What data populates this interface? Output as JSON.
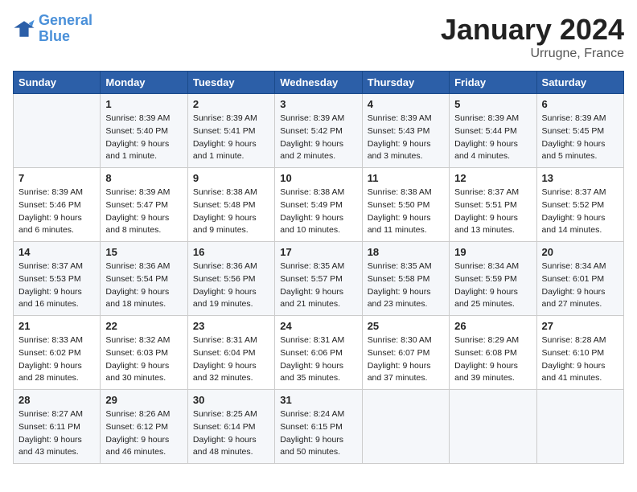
{
  "header": {
    "logo_line1": "General",
    "logo_line2": "Blue",
    "month": "January 2024",
    "location": "Urrugne, France"
  },
  "weekdays": [
    "Sunday",
    "Monday",
    "Tuesday",
    "Wednesday",
    "Thursday",
    "Friday",
    "Saturday"
  ],
  "weeks": [
    [
      {
        "day": "",
        "info": ""
      },
      {
        "day": "1",
        "info": "Sunrise: 8:39 AM\nSunset: 5:40 PM\nDaylight: 9 hours\nand 1 minute."
      },
      {
        "day": "2",
        "info": "Sunrise: 8:39 AM\nSunset: 5:41 PM\nDaylight: 9 hours\nand 1 minute."
      },
      {
        "day": "3",
        "info": "Sunrise: 8:39 AM\nSunset: 5:42 PM\nDaylight: 9 hours\nand 2 minutes."
      },
      {
        "day": "4",
        "info": "Sunrise: 8:39 AM\nSunset: 5:43 PM\nDaylight: 9 hours\nand 3 minutes."
      },
      {
        "day": "5",
        "info": "Sunrise: 8:39 AM\nSunset: 5:44 PM\nDaylight: 9 hours\nand 4 minutes."
      },
      {
        "day": "6",
        "info": "Sunrise: 8:39 AM\nSunset: 5:45 PM\nDaylight: 9 hours\nand 5 minutes."
      }
    ],
    [
      {
        "day": "7",
        "info": "Sunrise: 8:39 AM\nSunset: 5:46 PM\nDaylight: 9 hours\nand 6 minutes."
      },
      {
        "day": "8",
        "info": "Sunrise: 8:39 AM\nSunset: 5:47 PM\nDaylight: 9 hours\nand 8 minutes."
      },
      {
        "day": "9",
        "info": "Sunrise: 8:38 AM\nSunset: 5:48 PM\nDaylight: 9 hours\nand 9 minutes."
      },
      {
        "day": "10",
        "info": "Sunrise: 8:38 AM\nSunset: 5:49 PM\nDaylight: 9 hours\nand 10 minutes."
      },
      {
        "day": "11",
        "info": "Sunrise: 8:38 AM\nSunset: 5:50 PM\nDaylight: 9 hours\nand 11 minutes."
      },
      {
        "day": "12",
        "info": "Sunrise: 8:37 AM\nSunset: 5:51 PM\nDaylight: 9 hours\nand 13 minutes."
      },
      {
        "day": "13",
        "info": "Sunrise: 8:37 AM\nSunset: 5:52 PM\nDaylight: 9 hours\nand 14 minutes."
      }
    ],
    [
      {
        "day": "14",
        "info": "Sunrise: 8:37 AM\nSunset: 5:53 PM\nDaylight: 9 hours\nand 16 minutes."
      },
      {
        "day": "15",
        "info": "Sunrise: 8:36 AM\nSunset: 5:54 PM\nDaylight: 9 hours\nand 18 minutes."
      },
      {
        "day": "16",
        "info": "Sunrise: 8:36 AM\nSunset: 5:56 PM\nDaylight: 9 hours\nand 19 minutes."
      },
      {
        "day": "17",
        "info": "Sunrise: 8:35 AM\nSunset: 5:57 PM\nDaylight: 9 hours\nand 21 minutes."
      },
      {
        "day": "18",
        "info": "Sunrise: 8:35 AM\nSunset: 5:58 PM\nDaylight: 9 hours\nand 23 minutes."
      },
      {
        "day": "19",
        "info": "Sunrise: 8:34 AM\nSunset: 5:59 PM\nDaylight: 9 hours\nand 25 minutes."
      },
      {
        "day": "20",
        "info": "Sunrise: 8:34 AM\nSunset: 6:01 PM\nDaylight: 9 hours\nand 27 minutes."
      }
    ],
    [
      {
        "day": "21",
        "info": "Sunrise: 8:33 AM\nSunset: 6:02 PM\nDaylight: 9 hours\nand 28 minutes."
      },
      {
        "day": "22",
        "info": "Sunrise: 8:32 AM\nSunset: 6:03 PM\nDaylight: 9 hours\nand 30 minutes."
      },
      {
        "day": "23",
        "info": "Sunrise: 8:31 AM\nSunset: 6:04 PM\nDaylight: 9 hours\nand 32 minutes."
      },
      {
        "day": "24",
        "info": "Sunrise: 8:31 AM\nSunset: 6:06 PM\nDaylight: 9 hours\nand 35 minutes."
      },
      {
        "day": "25",
        "info": "Sunrise: 8:30 AM\nSunset: 6:07 PM\nDaylight: 9 hours\nand 37 minutes."
      },
      {
        "day": "26",
        "info": "Sunrise: 8:29 AM\nSunset: 6:08 PM\nDaylight: 9 hours\nand 39 minutes."
      },
      {
        "day": "27",
        "info": "Sunrise: 8:28 AM\nSunset: 6:10 PM\nDaylight: 9 hours\nand 41 minutes."
      }
    ],
    [
      {
        "day": "28",
        "info": "Sunrise: 8:27 AM\nSunset: 6:11 PM\nDaylight: 9 hours\nand 43 minutes."
      },
      {
        "day": "29",
        "info": "Sunrise: 8:26 AM\nSunset: 6:12 PM\nDaylight: 9 hours\nand 46 minutes."
      },
      {
        "day": "30",
        "info": "Sunrise: 8:25 AM\nSunset: 6:14 PM\nDaylight: 9 hours\nand 48 minutes."
      },
      {
        "day": "31",
        "info": "Sunrise: 8:24 AM\nSunset: 6:15 PM\nDaylight: 9 hours\nand 50 minutes."
      },
      {
        "day": "",
        "info": ""
      },
      {
        "day": "",
        "info": ""
      },
      {
        "day": "",
        "info": ""
      }
    ]
  ]
}
